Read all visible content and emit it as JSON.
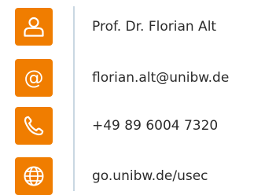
{
  "colors": {
    "icon_background": "#F07D00",
    "icon_foreground": "#FFFFFF",
    "divider": "#C9D7E2",
    "text": "#2B2B2B"
  },
  "contacts": [
    {
      "icon": "person-icon",
      "text": "Prof. Dr. Florian Alt"
    },
    {
      "icon": "at-sign-icon",
      "text": "florian.alt@unibw.de"
    },
    {
      "icon": "phone-icon",
      "text": "+49 89 6004 7320"
    },
    {
      "icon": "globe-icon",
      "text": "go.unibw.de/usec"
    }
  ]
}
